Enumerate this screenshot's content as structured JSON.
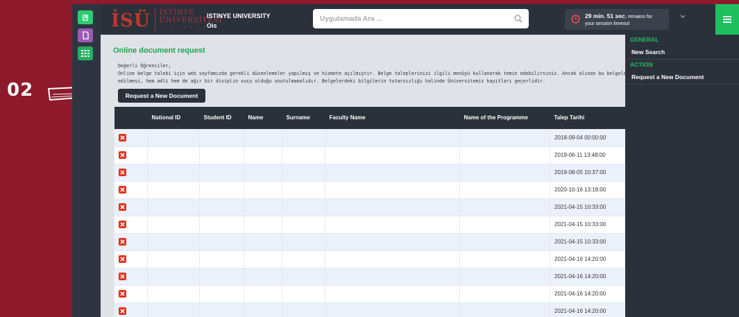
{
  "annotation": {
    "step": "02"
  },
  "header": {
    "logo_mark": "İSÜ",
    "logo_line1": "İSTİNYE",
    "logo_line2": "ÜNİVERSİTESİ",
    "logo_line3": "İ S T A N B U L",
    "university": "ISTINYE UNIVERSITY",
    "app_name": "Ois",
    "search_placeholder": "Uygulamada Ara ...",
    "timeout_value": "29 min. 51 sec.",
    "timeout_suffix": " remains for",
    "timeout_line2": "your session timeout"
  },
  "content": {
    "title": "Online document request",
    "greeting": "Değerli Öğrenciler,",
    "line1": "Online belge talebi için web sayfamızda gerekli düzenlemeler yapılmış ve hizmete açılmıştır. Belge taleplerinizi ilgili menüyü kullanarak temin edebilirsiniz. Ancak alınan bu belgelerin amacı dışında ku",
    "line2": "edilmesi, hem adli hem de ağır bir disiplin suçu olduğu unutulmamalıdır. Belgelerdeki bilgilerin tutarsızlığı halinde Üniversitemiz kayıtları geçerlidir.",
    "request_button": "Request a New Document"
  },
  "table": {
    "columns": [
      "",
      "National ID",
      "Student ID",
      "Name",
      "Surname",
      "Faculty Name",
      "Name of the Programme",
      "Talep Tarihi"
    ],
    "rows": [
      "2018-09-04 00:00:00",
      "2019-06-11 13:48:00",
      "2019-08-05 10:37:00",
      "2020-10-16 13:18:00",
      "2021-04-15 10:33:00",
      "2021-04-15 10:33:00",
      "2021-04-15 10:33:00",
      "2021-04-16 14:20:00",
      "2021-04-16 14:20:00",
      "2021-04-16 14:20:00",
      "2021-04-16 14:20:00"
    ]
  },
  "panel": {
    "general": "GENERAL",
    "new_search": "New Search",
    "action": "ACTION",
    "request_new": "Request a New Document"
  },
  "colors": {
    "accent_green": "#1fbf5f",
    "background": "#8e1a2b",
    "delete_red": "#e0321f"
  }
}
